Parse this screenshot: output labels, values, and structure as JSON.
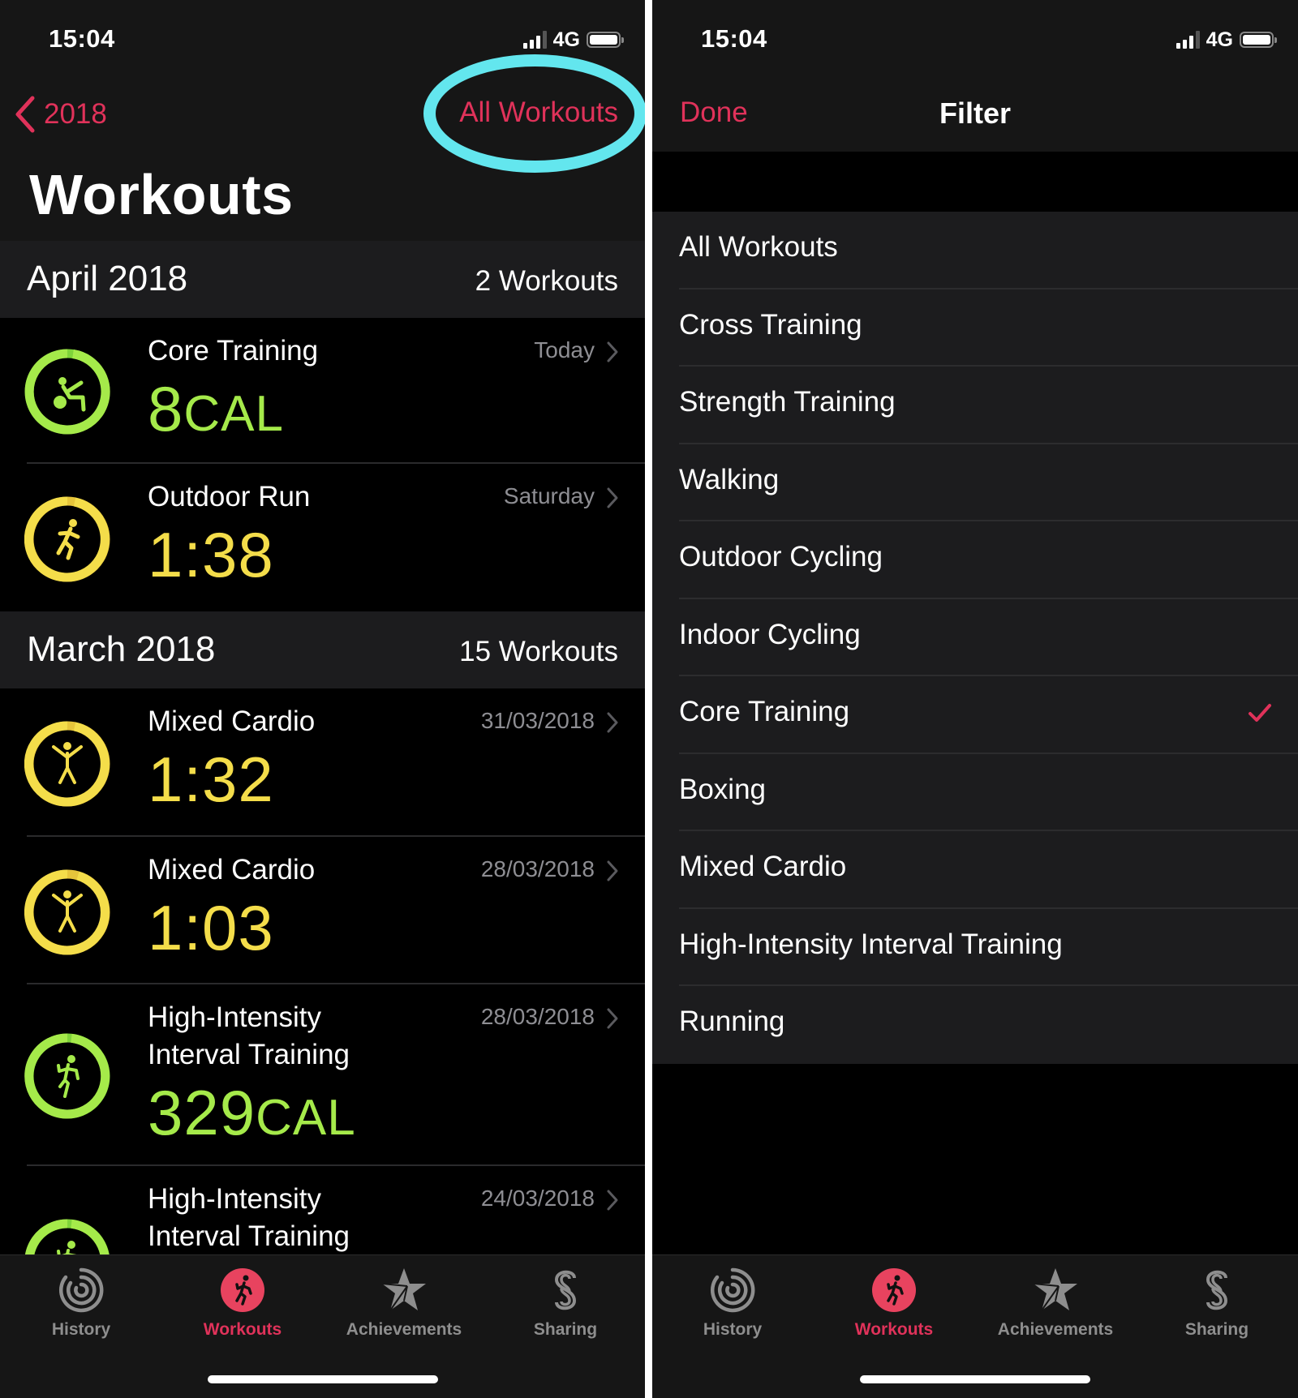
{
  "left": {
    "status_bar": {
      "time": "15:04",
      "network": "4G"
    },
    "nav": {
      "back_label": "2018",
      "filter_button": "All Workouts"
    },
    "title": "Workouts",
    "sections": [
      {
        "month": "April 2018",
        "count": "2 Workouts",
        "workouts": [
          {
            "name": "Core Training",
            "value": "8",
            "unit": "CAL",
            "date": "Today",
            "color": "#a5ea4a",
            "icon": "core-training-icon"
          },
          {
            "name": "Outdoor Run",
            "value": "1:38",
            "unit": "",
            "date": "Saturday",
            "color": "#f4dd4a",
            "icon": "running-icon"
          }
        ]
      },
      {
        "month": "March 2018",
        "count": "15 Workouts",
        "workouts": [
          {
            "name": "Mixed Cardio",
            "value": "1:32",
            "unit": "",
            "date": "31/03/2018",
            "color": "#f4dd4a",
            "icon": "mixed-cardio-icon"
          },
          {
            "name": "Mixed Cardio",
            "value": "1:03",
            "unit": "",
            "date": "28/03/2018",
            "color": "#f4dd4a",
            "icon": "mixed-cardio-icon"
          },
          {
            "name_line1": "High-Intensity",
            "name_line2": "Interval Training",
            "value": "329",
            "unit": "CAL",
            "date": "28/03/2018",
            "color": "#a5ea4a",
            "icon": "hiit-icon"
          },
          {
            "name_line1": "High-Intensity",
            "name_line2": "Interval Training",
            "value": "",
            "unit": "",
            "date": "24/03/2018",
            "color": "#a5ea4a",
            "icon": "hiit-icon"
          }
        ]
      }
    ]
  },
  "right": {
    "status_bar": {
      "time": "15:04",
      "network": "4G"
    },
    "nav": {
      "done_label": "Done",
      "title": "Filter"
    },
    "filter_options": [
      {
        "label": "All Workouts",
        "selected": false
      },
      {
        "label": "Cross Training",
        "selected": false
      },
      {
        "label": "Strength Training",
        "selected": false
      },
      {
        "label": "Walking",
        "selected": false
      },
      {
        "label": "Outdoor Cycling",
        "selected": false
      },
      {
        "label": "Indoor Cycling",
        "selected": false
      },
      {
        "label": "Core Training",
        "selected": true
      },
      {
        "label": "Boxing",
        "selected": false
      },
      {
        "label": "Mixed Cardio",
        "selected": false
      },
      {
        "label": "High-Intensity Interval Training",
        "selected": false
      },
      {
        "label": "Running",
        "selected": false
      }
    ]
  },
  "tab_bar": {
    "tabs": [
      {
        "label": "History",
        "icon": "history-rings-icon",
        "active": false
      },
      {
        "label": "Workouts",
        "icon": "workouts-runner-icon",
        "active": true
      },
      {
        "label": "Achievements",
        "icon": "achievements-star-icon",
        "active": false
      },
      {
        "label": "Sharing",
        "icon": "sharing-s-icon",
        "active": false
      }
    ]
  },
  "colors": {
    "accent": "#e0325a",
    "move_green": "#a5ea4a",
    "exercise_yellow": "#f4dd4a",
    "annotation": "#63e6ee"
  }
}
